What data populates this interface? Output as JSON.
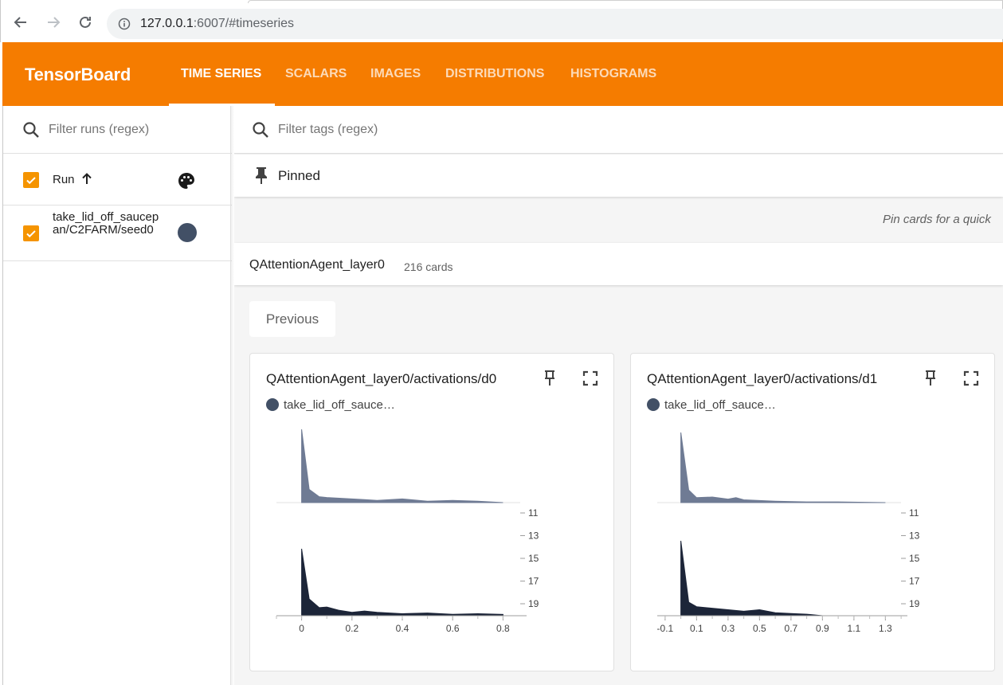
{
  "browser": {
    "url_host": "127.0.0.1",
    "url_rest": ":6007/#timeseries"
  },
  "header": {
    "logo": "TensorBoard",
    "tabs": [
      {
        "label": "TIME SERIES",
        "active": true
      },
      {
        "label": "SCALARS",
        "active": false
      },
      {
        "label": "IMAGES",
        "active": false
      },
      {
        "label": "DISTRIBUTIONS",
        "active": false
      },
      {
        "label": "HISTOGRAMS",
        "active": false
      }
    ],
    "bg_color": "#f57c00"
  },
  "sidebar": {
    "filter_placeholder": "Filter runs (regex)",
    "run_header_label": "Run",
    "runs": [
      {
        "name": "take_lid_off_saucepan/C2FARM/seed0",
        "checked": true,
        "color": "#425066"
      }
    ]
  },
  "main": {
    "tag_filter_placeholder": "Filter tags (regex)",
    "pinned_label": "Pinned",
    "pin_hint": "Pin cards for a quick",
    "group": {
      "name": "QAttentionAgent_layer0",
      "count": "216 cards"
    },
    "previous_label": "Previous",
    "cards": [
      {
        "title": "QAttentionAgent_layer0/activations/d0",
        "legend": "take_lid_off_sauce…"
      },
      {
        "title": "QAttentionAgent_layer0/activations/d1",
        "legend": "take_lid_off_sauce…"
      }
    ]
  },
  "chart_data": [
    {
      "type": "area",
      "title": "QAttentionAgent_layer0/activations/d0",
      "series_color": "#425066",
      "x_ticks": [
        "0",
        "0.2",
        "0.4",
        "0.6",
        "0.8"
      ],
      "xlim": [
        -0.1,
        0.9
      ],
      "y_ticks": [
        "11",
        "13",
        "15",
        "17",
        "19"
      ],
      "histograms": [
        {
          "step": "11",
          "x": [
            0,
            0.03,
            0.07,
            0.1,
            0.15,
            0.2,
            0.25,
            0.3,
            0.4,
            0.5,
            0.6,
            0.7,
            0.8
          ],
          "y": [
            1.0,
            0.18,
            0.08,
            0.07,
            0.06,
            0.05,
            0.04,
            0.03,
            0.05,
            0.02,
            0.03,
            0.02,
            0.0
          ]
        },
        {
          "step": "19",
          "x": [
            0,
            0.03,
            0.07,
            0.1,
            0.15,
            0.2,
            0.25,
            0.3,
            0.4,
            0.5,
            0.6,
            0.7,
            0.8
          ],
          "y": [
            1.0,
            0.25,
            0.12,
            0.13,
            0.08,
            0.05,
            0.07,
            0.05,
            0.03,
            0.04,
            0.02,
            0.03,
            0.02
          ]
        }
      ]
    },
    {
      "type": "area",
      "title": "QAttentionAgent_layer0/activations/d1",
      "series_color": "#425066",
      "x_ticks": [
        "-0.1",
        "0.1",
        "0.3",
        "0.5",
        "0.7",
        "0.9",
        "1.1",
        "1.3"
      ],
      "xlim": [
        -0.15,
        1.45
      ],
      "y_ticks": [
        "11",
        "13",
        "15",
        "17",
        "19"
      ],
      "histograms": [
        {
          "step": "11",
          "x": [
            0,
            0.05,
            0.1,
            0.2,
            0.3,
            0.35,
            0.4,
            0.5,
            0.6,
            0.8,
            1.0,
            1.3
          ],
          "y": [
            1.0,
            0.18,
            0.07,
            0.08,
            0.05,
            0.07,
            0.04,
            0.03,
            0.02,
            0.01,
            0.01,
            0.0
          ]
        },
        {
          "step": "19",
          "x": [
            0,
            0.05,
            0.1,
            0.2,
            0.3,
            0.4,
            0.5,
            0.6,
            0.7,
            0.8,
            0.9
          ],
          "y": [
            1.0,
            0.18,
            0.12,
            0.1,
            0.08,
            0.06,
            0.08,
            0.04,
            0.03,
            0.02,
            0.0
          ]
        }
      ]
    }
  ]
}
